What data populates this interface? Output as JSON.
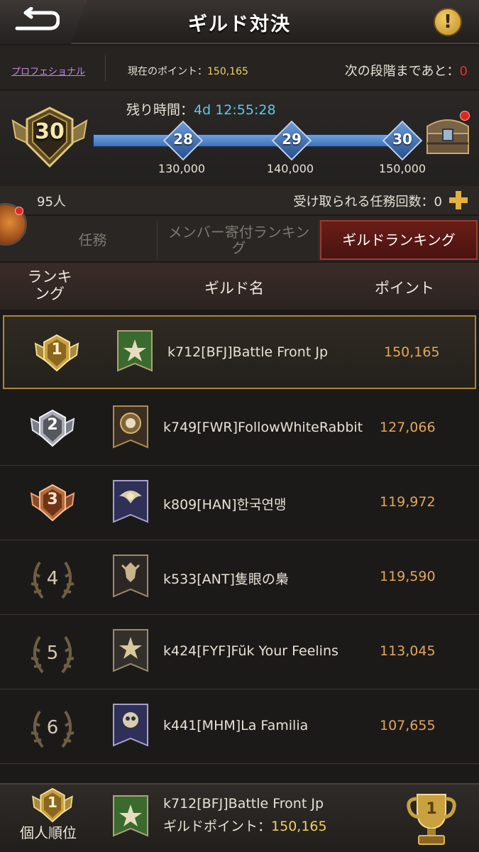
{
  "header": {
    "title": "ギルド対決",
    "info_symbol": "!"
  },
  "points_bar": {
    "tier_link": "プロフェショナル",
    "current_points_label": "現在のポイント：",
    "current_points": "150,165",
    "next_stage_label": "次の段階まであと：",
    "next_stage_value": "0"
  },
  "progress": {
    "level": "30",
    "remaining_label": "残り時間：",
    "remaining_value": "4d 12:55:28",
    "milestones": [
      {
        "level": "28",
        "points": "130,000"
      },
      {
        "level": "29",
        "points": "140,000"
      },
      {
        "level": "30",
        "points": "150,000"
      }
    ]
  },
  "members": {
    "count": "95人",
    "missions_label": "受け取られる任務回数：0"
  },
  "tabs": [
    {
      "label": "任務",
      "active": false
    },
    {
      "label": "メンバー寄付ランキング",
      "active": false
    },
    {
      "label": "ギルドランキング",
      "active": true
    }
  ],
  "columns": {
    "rank": "ランキング",
    "name": "ギルド名",
    "points": "ポイント"
  },
  "rankings": [
    {
      "rank": "1",
      "name": "k712[BFJ]Battle Front Jp",
      "points": "150,165"
    },
    {
      "rank": "2",
      "name": "k749[FWR]FollowWhiteRabbit",
      "points": "127,066"
    },
    {
      "rank": "3",
      "name": "k809[HAN]한국연맹",
      "points": "119,972"
    },
    {
      "rank": "4",
      "name": "k533[ANT]隻眼の梟",
      "points": "119,590"
    },
    {
      "rank": "5",
      "name": "k424[FYF]Fŭk Your Feelins",
      "points": "113,045"
    },
    {
      "rank": "6",
      "name": "k441[MHM]La Familia",
      "points": "107,655"
    }
  ],
  "footer": {
    "personal_rank": "1",
    "personal_rank_label": "個人順位",
    "guild_name": "k712[BFJ]Battle Front Jp",
    "guild_points_label": "ギルドポイント：",
    "guild_points": "150,165",
    "trophy_rank": "1"
  },
  "colors": {
    "accent_gold": "#f2d25a",
    "points_orange": "#e2a75c",
    "timer_blue": "#5cc8ea",
    "alert_red": "#e2261e",
    "tab_active": "#6a1d18"
  }
}
